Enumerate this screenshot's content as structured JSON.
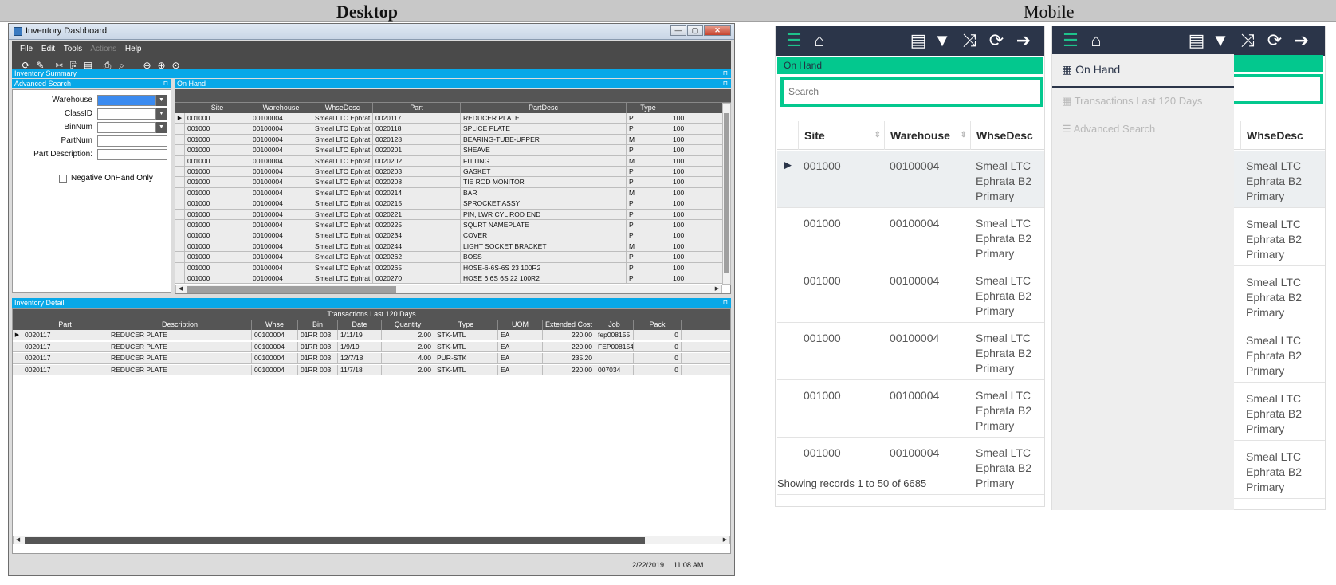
{
  "strip": {
    "desktop_label": "Desktop",
    "mobile_label": "Mobile"
  },
  "desktop": {
    "window_title": "Inventory Dashboard",
    "window_controls": {
      "minimize": "—",
      "maximize": "▢",
      "close": "✕"
    },
    "menu": [
      "File",
      "Edit",
      "Tools",
      "Actions",
      "Help"
    ],
    "menu_disabled": "Actions",
    "toolbar_icons": [
      "refresh-icon",
      "clear-icon",
      "cut-icon",
      "copy-icon",
      "paste-icon",
      "print-icon",
      "preview-icon",
      "back-icon",
      "forward-icon",
      "home-icon"
    ],
    "inventory_summary_label": "Inventory Summary",
    "advanced_search": {
      "title": "Advanced Search",
      "fields": [
        {
          "label": "Warehouse",
          "type": "dropdown"
        },
        {
          "label": "ClassID",
          "type": "dropdown"
        },
        {
          "label": "BinNum",
          "type": "dropdown"
        },
        {
          "label": "PartNum",
          "type": "text"
        },
        {
          "label": "Part Description:",
          "type": "text"
        }
      ],
      "checkbox_label": "Negative OnHand Only"
    },
    "on_hand": {
      "title": "On Hand",
      "columns": [
        "Site",
        "Warehouse",
        "WhseDesc",
        "Part",
        "PartDesc",
        "Type",
        ""
      ],
      "rows": [
        [
          "001000",
          "00100004",
          "Smeal LTC Ephrat",
          "0020117",
          "REDUCER PLATE",
          "P",
          "100"
        ],
        [
          "001000",
          "00100004",
          "Smeal LTC Ephrat",
          "0020118",
          "SPLICE PLATE",
          "P",
          "100"
        ],
        [
          "001000",
          "00100004",
          "Smeal LTC Ephrat",
          "0020128",
          "BEARING-TUBE-UPPER",
          "M",
          "100"
        ],
        [
          "001000",
          "00100004",
          "Smeal LTC Ephrat",
          "0020201",
          "SHEAVE",
          "P",
          "100"
        ],
        [
          "001000",
          "00100004",
          "Smeal LTC Ephrat",
          "0020202",
          "FITTING",
          "M",
          "100"
        ],
        [
          "001000",
          "00100004",
          "Smeal LTC Ephrat",
          "0020203",
          "GASKET",
          "P",
          "100"
        ],
        [
          "001000",
          "00100004",
          "Smeal LTC Ephrat",
          "0020208",
          "TIE ROD MONITOR",
          "P",
          "100"
        ],
        [
          "001000",
          "00100004",
          "Smeal LTC Ephrat",
          "0020214",
          "BAR",
          "M",
          "100"
        ],
        [
          "001000",
          "00100004",
          "Smeal LTC Ephrat",
          "0020215",
          "SPROCKET ASSY",
          "P",
          "100"
        ],
        [
          "001000",
          "00100004",
          "Smeal LTC Ephrat",
          "0020221",
          "PIN, LWR CYL ROD END",
          "P",
          "100"
        ],
        [
          "001000",
          "00100004",
          "Smeal LTC Ephrat",
          "0020225",
          "SQURT NAMEPLATE",
          "P",
          "100"
        ],
        [
          "001000",
          "00100004",
          "Smeal LTC Ephrat",
          "0020234",
          "COVER",
          "P",
          "100"
        ],
        [
          "001000",
          "00100004",
          "Smeal LTC Ephrat",
          "0020244",
          "LIGHT SOCKET BRACKET",
          "M",
          "100"
        ],
        [
          "001000",
          "00100004",
          "Smeal LTC Ephrat",
          "0020262",
          "BOSS",
          "P",
          "100"
        ],
        [
          "001000",
          "00100004",
          "Smeal LTC Ephrat",
          "0020265",
          "HOSE-6-6S-6S 23 100R2",
          "P",
          "100"
        ],
        [
          "001000",
          "00100004",
          "Smeal LTC Ephrat",
          "0020270",
          "HOSE 6 6S 6S 22 100R2",
          "P",
          "100"
        ]
      ]
    },
    "inventory_detail": {
      "title": "Inventory Detail",
      "subtitle": "Transactions Last 120 Days",
      "columns": [
        "Part",
        "Description",
        "Whse",
        "Bin",
        "Date",
        "Quantity",
        "Type",
        "UOM",
        "Extended Cost",
        "Job",
        "Pack"
      ],
      "rows": [
        [
          "0020117",
          "REDUCER PLATE",
          "00100004",
          "01RR 003",
          "1/11/19",
          "2.00",
          "STK-MTL",
          "EA",
          "220.00",
          "fep008155",
          "0"
        ],
        [
          "0020117",
          "REDUCER PLATE",
          "00100004",
          "01RR 003",
          "1/9/19",
          "2.00",
          "STK-MTL",
          "EA",
          "220.00",
          "FEP008154",
          "0"
        ],
        [
          "0020117",
          "REDUCER PLATE",
          "00100004",
          "01RR 003",
          "12/7/18",
          "4.00",
          "PUR-STK",
          "EA",
          "235.20",
          "",
          "0"
        ],
        [
          "0020117",
          "REDUCER PLATE",
          "00100004",
          "01RR 003",
          "11/7/18",
          "2.00",
          "STK-MTL",
          "EA",
          "220.00",
          "007034",
          "0"
        ]
      ]
    },
    "status": {
      "date": "2/22/2019",
      "time": "11:08 AM"
    }
  },
  "mobile": {
    "top_icons": [
      "menu-icon",
      "home-icon",
      "list-icon",
      "filter-icon",
      "shuffle-icon",
      "refresh-icon",
      "arrow-right-icon"
    ],
    "section_title": "On Hand",
    "search_placeholder": "Search",
    "columns": [
      "Site",
      "Warehouse",
      "WhseDesc"
    ],
    "rows": [
      [
        "001000",
        "00100004",
        "Smeal LTC",
        "Ephrata B2",
        "Primary"
      ],
      [
        "001000",
        "00100004",
        "Smeal LTC",
        "Ephrata B2",
        "Primary"
      ],
      [
        "001000",
        "00100004",
        "Smeal LTC",
        "Ephrata B2",
        "Primary"
      ],
      [
        "001000",
        "00100004",
        "Smeal LTC",
        "Ephrata B2",
        "Primary"
      ],
      [
        "001000",
        "00100004",
        "Smeal LTC",
        "Ephrata B2",
        "Primary"
      ],
      [
        "001000",
        "00100004",
        "Smeal LTC",
        "Ephrata B2",
        "Primary"
      ]
    ],
    "footer": "Showing records 1 to 50 of 6685",
    "drawer_items": [
      "On Hand",
      "Transactions Last 120 Days",
      "Advanced Search"
    ],
    "drawer_column": "WhseDesc"
  }
}
